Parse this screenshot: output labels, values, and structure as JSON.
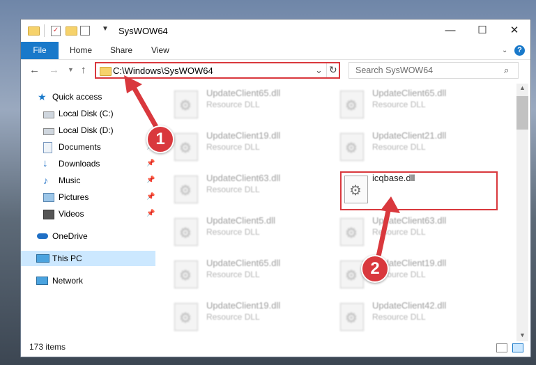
{
  "window": {
    "title": "SysWOW64",
    "controls": {
      "minimize": "—",
      "maximize": "☐",
      "close": "✕"
    }
  },
  "ribbon": {
    "tabs": [
      "File",
      "Home",
      "Share",
      "View"
    ],
    "help": "?"
  },
  "address": {
    "path": "C:\\Windows\\SysWOW64",
    "search_placeholder": "Search SysWOW64"
  },
  "sidebar": {
    "items": [
      {
        "label": "Quick access",
        "icon": "star-icon"
      },
      {
        "label": "Local Disk (C:)",
        "icon": "drive-icon"
      },
      {
        "label": "Local Disk (D:)",
        "icon": "drive-icon"
      },
      {
        "label": "Documents",
        "icon": "documents-icon",
        "pinned": true
      },
      {
        "label": "Downloads",
        "icon": "download-icon",
        "pinned": true
      },
      {
        "label": "Music",
        "icon": "music-icon",
        "pinned": true
      },
      {
        "label": "Pictures",
        "icon": "pictures-icon",
        "pinned": true
      },
      {
        "label": "Videos",
        "icon": "videos-icon",
        "pinned": true
      },
      {
        "label": "OneDrive",
        "icon": "cloud-icon"
      },
      {
        "label": "This PC",
        "icon": "computer-icon",
        "selected": true
      },
      {
        "label": "Network",
        "icon": "network-icon"
      }
    ]
  },
  "files": [
    {
      "name": "UpdateClient65.dll",
      "type": "Resource DLL"
    },
    {
      "name": "UpdateClient65.dll",
      "type": "Resource DLL"
    },
    {
      "name": "UpdateClient19.dll",
      "type": "Resource DLL"
    },
    {
      "name": "UpdateClient21.dll",
      "type": "Resource DLL"
    },
    {
      "name": "UpdateClient63.dll",
      "type": "Resource DLL"
    },
    {
      "name": "icqbase.dll",
      "type": ""
    },
    {
      "name": "UpdateClient5.dll",
      "type": "Resource DLL"
    },
    {
      "name": "UpdateClient63.dll",
      "type": "Resource DLL"
    },
    {
      "name": "UpdateClient65.dll",
      "type": "Resource DLL"
    },
    {
      "name": "UpdateClient19.dll",
      "type": "Resource DLL"
    },
    {
      "name": "UpdateClient19.dll",
      "type": "Resource DLL"
    },
    {
      "name": "UpdateClient42.dll",
      "type": "Resource DLL"
    }
  ],
  "status": {
    "count": "173 items"
  },
  "annotations": {
    "step1": "1",
    "step2": "2",
    "color": "#d9383d"
  }
}
